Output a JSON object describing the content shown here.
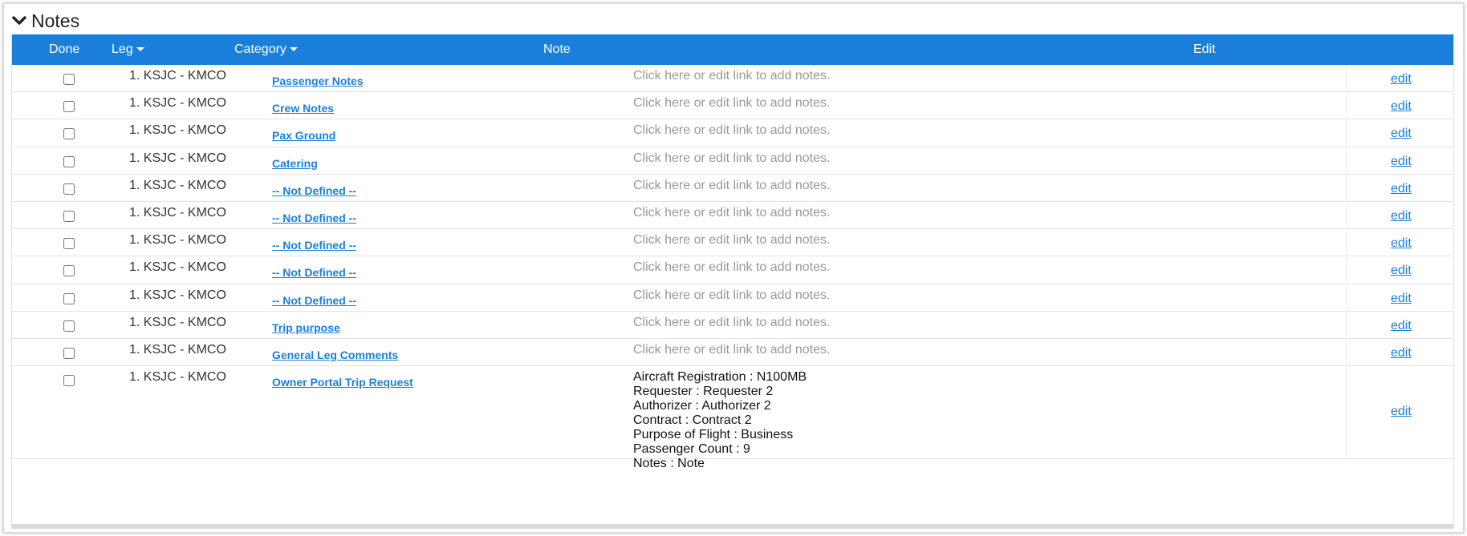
{
  "section": {
    "title": "Notes"
  },
  "table": {
    "headers": {
      "done": "Done",
      "leg": "Leg",
      "category": "Category",
      "note": "Note",
      "edit": "Edit"
    },
    "rows": [
      {
        "leg": "1. KSJC - KMCO",
        "category": "Passenger Notes",
        "note": "Click here or edit link to add notes.",
        "edit": "edit",
        "done": false
      },
      {
        "leg": "1. KSJC - KMCO",
        "category": "Crew Notes",
        "note": "Click here or edit link to add notes.",
        "edit": "edit",
        "done": false
      },
      {
        "leg": "1. KSJC - KMCO",
        "category": "Pax Ground",
        "note": "Click here or edit link to add notes.",
        "edit": "edit",
        "done": false
      },
      {
        "leg": "1. KSJC - KMCO",
        "category": "Catering",
        "note": "Click here or edit link to add notes.",
        "edit": "edit",
        "done": false
      },
      {
        "leg": "1. KSJC - KMCO",
        "category": "-- Not Defined --",
        "note": "Click here or edit link to add notes.",
        "edit": "edit",
        "done": false
      },
      {
        "leg": "1. KSJC - KMCO",
        "category": "-- Not Defined --",
        "note": "Click here or edit link to add notes.",
        "edit": "edit",
        "done": false
      },
      {
        "leg": "1. KSJC - KMCO",
        "category": "-- Not Defined --",
        "note": "Click here or edit link to add notes.",
        "edit": "edit",
        "done": false
      },
      {
        "leg": "1. KSJC - KMCO",
        "category": "-- Not Defined --",
        "note": "Click here or edit link to add notes.",
        "edit": "edit",
        "done": false
      },
      {
        "leg": "1. KSJC - KMCO",
        "category": "-- Not Defined --",
        "note": "Click here or edit link to add notes.",
        "edit": "edit",
        "done": false
      },
      {
        "leg": "1. KSJC - KMCO",
        "category": "Trip purpose",
        "note": "Click here or edit link to add notes.",
        "edit": "edit",
        "done": false
      },
      {
        "leg": "1. KSJC - KMCO",
        "category": "General Leg Comments",
        "note": "Click here or edit link to add notes.",
        "edit": "edit",
        "done": false
      },
      {
        "leg": "1. KSJC - KMCO",
        "category": "Owner Portal Trip Request",
        "edit": "edit",
        "done": false,
        "note_lines": [
          "Aircraft Registration : N100MB",
          "Requester : Requester 2",
          "Authorizer : Authorizer 2",
          "Contract : Contract 2",
          "Purpose of Flight : Business",
          "Passenger Count : 9",
          "Notes : Note"
        ]
      }
    ]
  },
  "colors": {
    "header_bg": "#1a7fdb",
    "link": "#1a7fdb",
    "placeholder_text": "#999999"
  },
  "icons": {
    "collapse": "chevron-down-icon",
    "sort": "caret-down-icon"
  }
}
